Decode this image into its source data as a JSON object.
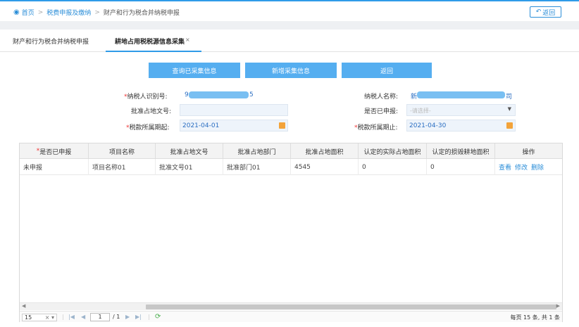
{
  "breadcrumb": {
    "home": "首页",
    "level1": "税费申报及缴纳",
    "current": "财产和行为税合并纳税申报"
  },
  "header": {
    "back_label": "返回"
  },
  "tabs": [
    {
      "label": "财产和行为税合并纳税申报"
    },
    {
      "label": "耕地占用税税源信息采集",
      "close": "×"
    }
  ],
  "actions": {
    "query_label": "查询已采集信息",
    "add_label": "新增采集信息",
    "return_label": "返回"
  },
  "form": {
    "taxpayer_id_label": "纳税人识别号:",
    "taxpayer_id_head": "9",
    "taxpayer_id_tail": "5",
    "taxpayer_name_label": "纳税人名称:",
    "taxpayer_name_head": "新",
    "taxpayer_name_tail": "司",
    "approval_doc_label": "批准占地文号:",
    "approval_doc_value": "",
    "declared_label": "是否已申报:",
    "declared_placeholder": "-请选择-",
    "period_start_label": "税款所属期起:",
    "period_start_value": "2021-04-01",
    "period_end_label": "税款所属期止:",
    "period_end_value": "2021-04-30",
    "required_mark": "*"
  },
  "table": {
    "columns": [
      "*是否已申报",
      "项目名称",
      "批准占地文号",
      "批准占地部门",
      "批准占地面积",
      "认定的实际占地面积",
      "认定的损毁耕地面积",
      "操作"
    ],
    "rows": [
      {
        "declared": "未申报",
        "project": "项目名称01",
        "doc_no": "批准文号01",
        "dept": "批准部门01",
        "area": "4545",
        "actual_area": "0",
        "damaged_area": "0",
        "ops": [
          "查看",
          "修改",
          "删除"
        ]
      }
    ]
  },
  "pager": {
    "page_size": "15",
    "current_page": "1",
    "total_pages": "/ 1",
    "summary": "每页 15 条, 共 1 条"
  },
  "colors": {
    "accent": "#2b8ed8",
    "button": "#55aef0",
    "required": "#e33333",
    "calendar_icon": "#f3a33a"
  }
}
